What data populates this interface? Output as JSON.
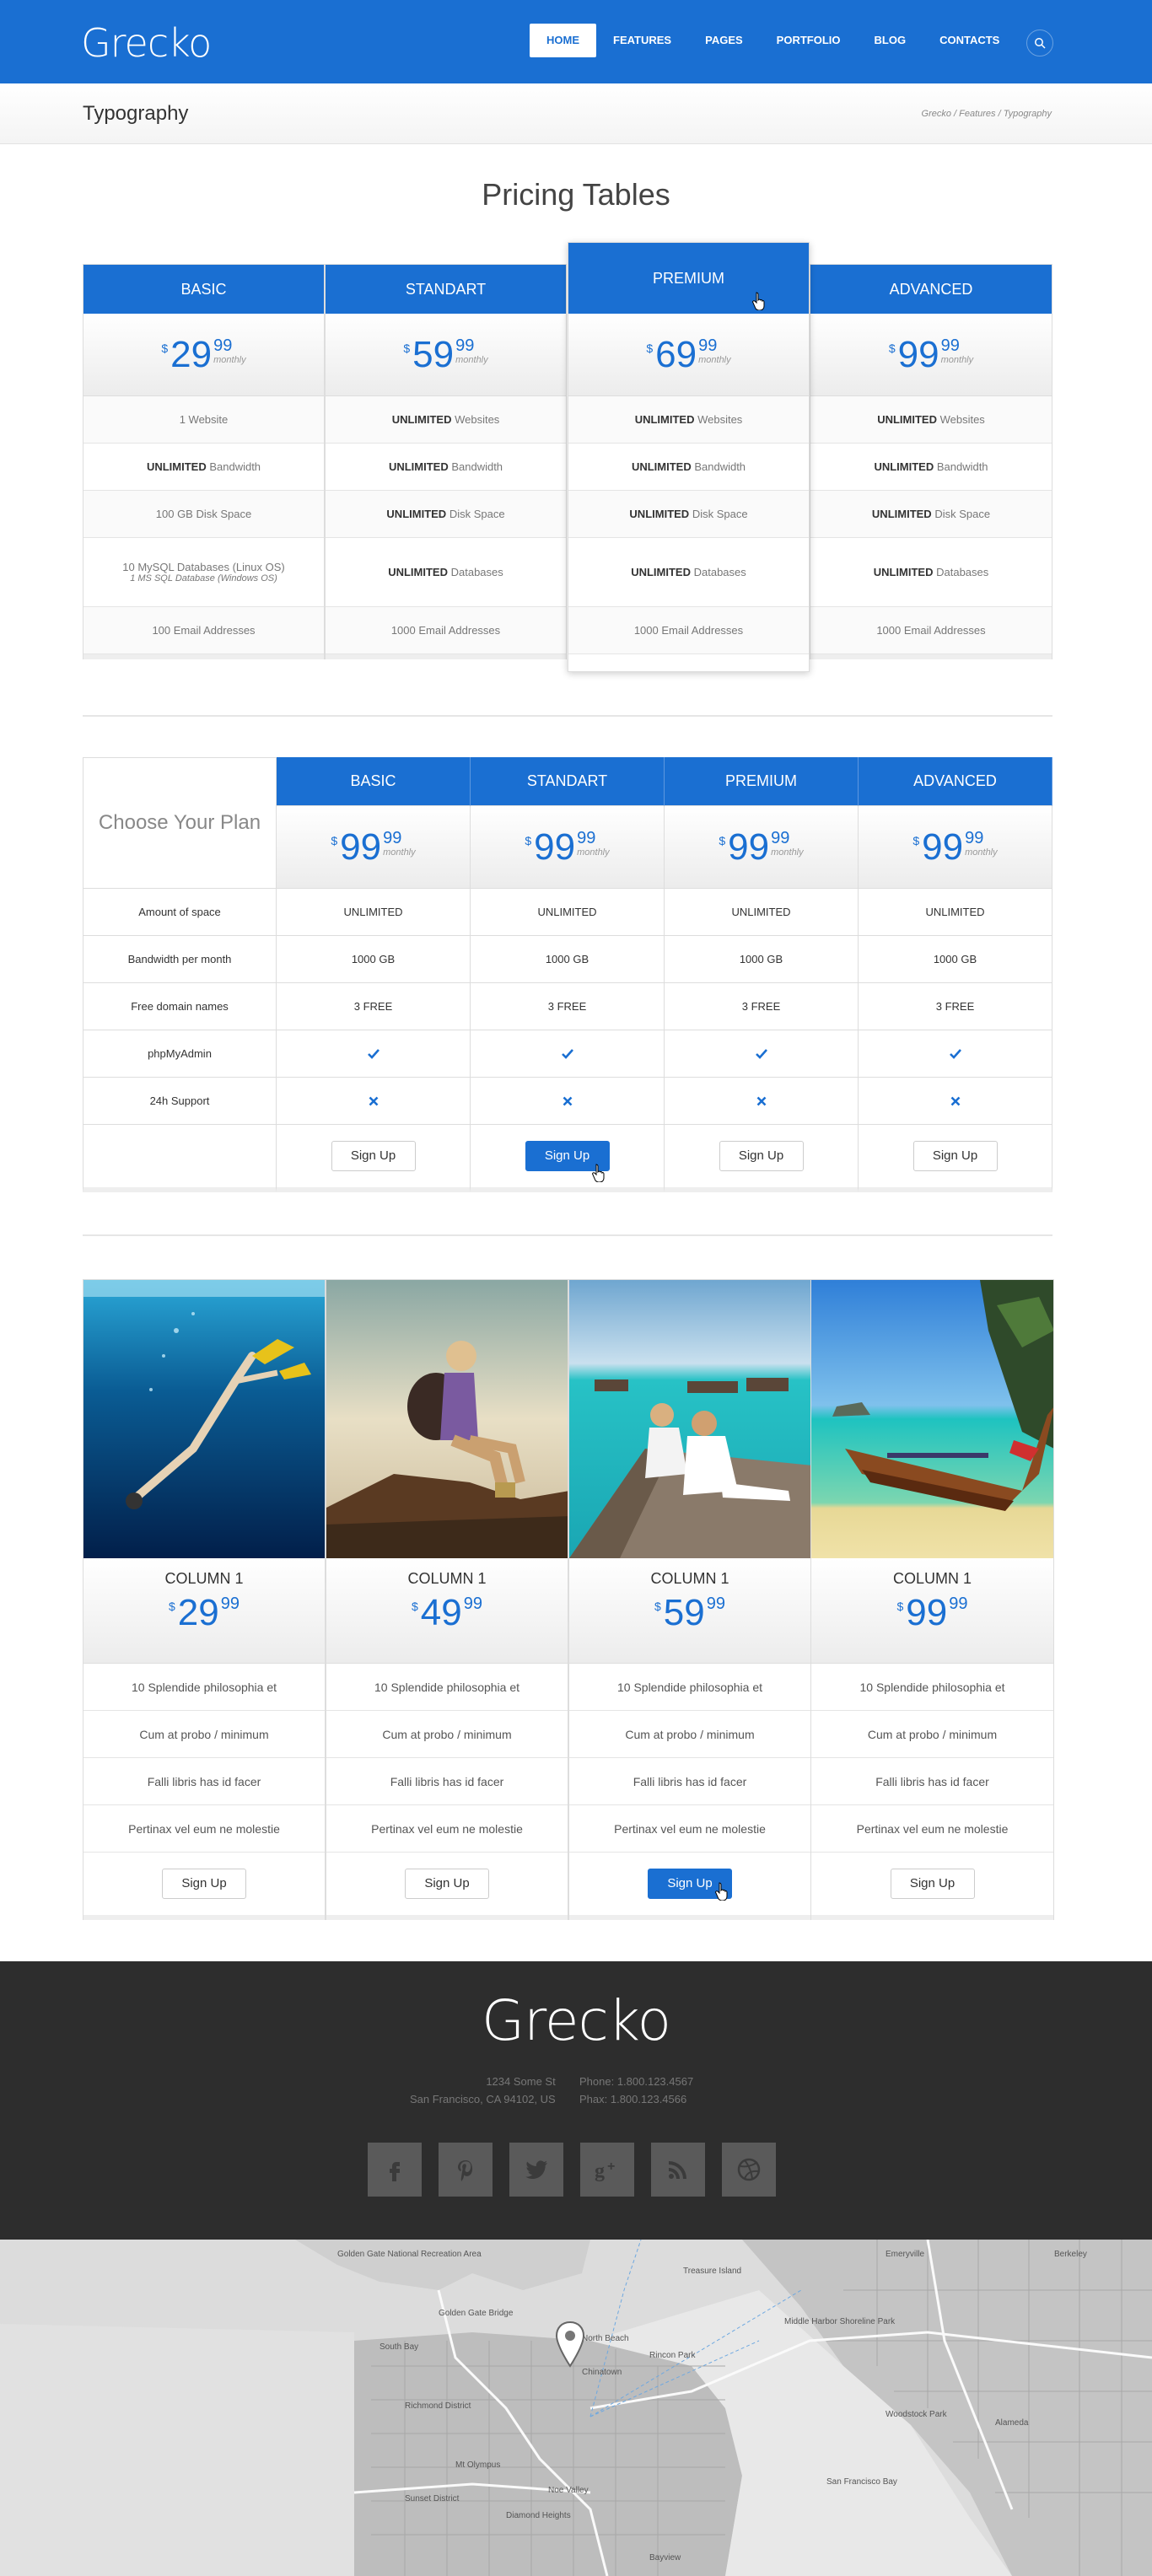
{
  "header": {
    "logo": "Grecko",
    "nav": [
      "HOME",
      "FEATURES",
      "PAGES",
      "PORTFOLIO",
      "BLOG",
      "CONTACTS"
    ],
    "active": "HOME",
    "search_icon": "search-icon"
  },
  "titlebar": {
    "title": "Typography",
    "breadcrumb": "Grecko / Features / Typography"
  },
  "pricing": {
    "title": "Pricing Tables",
    "plans": [
      {
        "name": "BASIC",
        "cur": "$",
        "int": "29",
        "cents": "99",
        "per": "monthly",
        "features": [
          {
            "b": "",
            "t": "1 Website"
          },
          {
            "b": "UNLIMITED",
            "t": " Bandwidth"
          },
          {
            "b": "",
            "t": "100 GB Disk Space"
          },
          {
            "b": "",
            "t": "10 MySQL Databases (Linux OS)",
            "sub": "1 MS SQL Database (Windows OS)"
          },
          {
            "b": "",
            "t": "100 Email Addresses"
          }
        ]
      },
      {
        "name": "STANDART",
        "cur": "$",
        "int": "59",
        "cents": "99",
        "per": "monthly",
        "features": [
          {
            "b": "UNLIMITED",
            "t": " Websites"
          },
          {
            "b": "UNLIMITED",
            "t": " Bandwidth"
          },
          {
            "b": "UNLIMITED",
            "t": " Disk Space"
          },
          {
            "b": "UNLIMITED",
            "t": " Databases"
          },
          {
            "b": "",
            "t": "1000 Email Addresses"
          }
        ]
      },
      {
        "name": "PREMIUM",
        "cur": "$",
        "int": "69",
        "cents": "99",
        "per": "monthly",
        "features": [
          {
            "b": "UNLIMITED",
            "t": " Websites"
          },
          {
            "b": "UNLIMITED",
            "t": " Bandwidth"
          },
          {
            "b": "UNLIMITED",
            "t": " Disk Space"
          },
          {
            "b": "UNLIMITED",
            "t": " Databases"
          },
          {
            "b": "",
            "t": "1000 Email Addresses"
          }
        ]
      },
      {
        "name": "ADVANCED",
        "cur": "$",
        "int": "99",
        "cents": "99",
        "per": "monthly",
        "features": [
          {
            "b": "UNLIMITED",
            "t": " Websites"
          },
          {
            "b": "UNLIMITED",
            "t": " Bandwidth"
          },
          {
            "b": "UNLIMITED",
            "t": " Disk Space"
          },
          {
            "b": "UNLIMITED",
            "t": " Databases"
          },
          {
            "b": "",
            "t": "1000 Email Addresses"
          }
        ]
      }
    ]
  },
  "compare": {
    "label": "Choose Your Plan",
    "plans": [
      "BASIC",
      "STANDART",
      "PREMIUM",
      "ADVANCED"
    ],
    "price": {
      "cur": "$",
      "int": "99",
      "cents": "99",
      "per": "monthly"
    },
    "rows": [
      {
        "label": "Amount of space",
        "values": [
          "UNLIMITED",
          "UNLIMITED",
          "UNLIMITED",
          "UNLIMITED"
        ]
      },
      {
        "label": "Bandwidth per month",
        "values": [
          "1000 GB",
          "1000 GB",
          "1000 GB",
          "1000 GB"
        ]
      },
      {
        "label": "Free domain names",
        "values": [
          "3 FREE",
          "3 FREE",
          "3 FREE",
          "3 FREE"
        ]
      },
      {
        "label": "phpMyAdmin",
        "values": [
          "check",
          "check",
          "check",
          "check"
        ]
      },
      {
        "label": "24h Support",
        "values": [
          "cross",
          "cross",
          "cross",
          "cross"
        ]
      }
    ],
    "button": "Sign Up"
  },
  "columns": {
    "items": [
      {
        "name": "COLUMN 1",
        "cur": "$",
        "int": "29",
        "cents": "99",
        "image": "diver-underwater"
      },
      {
        "name": "COLUMN 1",
        "cur": "$",
        "int": "49",
        "cents": "99",
        "image": "hiker-on-rock"
      },
      {
        "name": "COLUMN 1",
        "cur": "$",
        "int": "59",
        "cents": "99",
        "image": "couple-on-pier"
      },
      {
        "name": "COLUMN 1",
        "cur": "$",
        "int": "99",
        "cents": "99",
        "image": "longtail-boat-beach"
      }
    ],
    "features": [
      "10 Splendide philosophia et",
      "Cum at probo / minimum",
      "Falli libris has id facer",
      "Pertinax vel eum ne molestie"
    ],
    "button": "Sign Up"
  },
  "footer": {
    "logo": "Grecko",
    "address": [
      "1234 Some St",
      "San Francisco, CA 94102, US"
    ],
    "phone": [
      "Phone: 1.800.123.4567",
      "Phax: 1.800.123.4566"
    ],
    "social": [
      "facebook-icon",
      "pinterest-icon",
      "twitter-icon",
      "google-plus-icon",
      "rss-icon",
      "dribbble-icon"
    ]
  },
  "map": {
    "labels": [
      "Golden Gate National Recreation Area",
      "Golden Gate Bridge",
      "South Bay",
      "Richmond District",
      "North Beach",
      "Chinatown",
      "Rincon Park",
      "Treasure Island",
      "Middle Harbor Shoreline Park",
      "Emeryville",
      "Berkeley",
      "Alameda",
      "Woodstock Park",
      "San Francisco Bay",
      "Sunset District",
      "Diamond Heights",
      "Bayview",
      "Mt Olympus",
      "Noe Valley"
    ]
  }
}
